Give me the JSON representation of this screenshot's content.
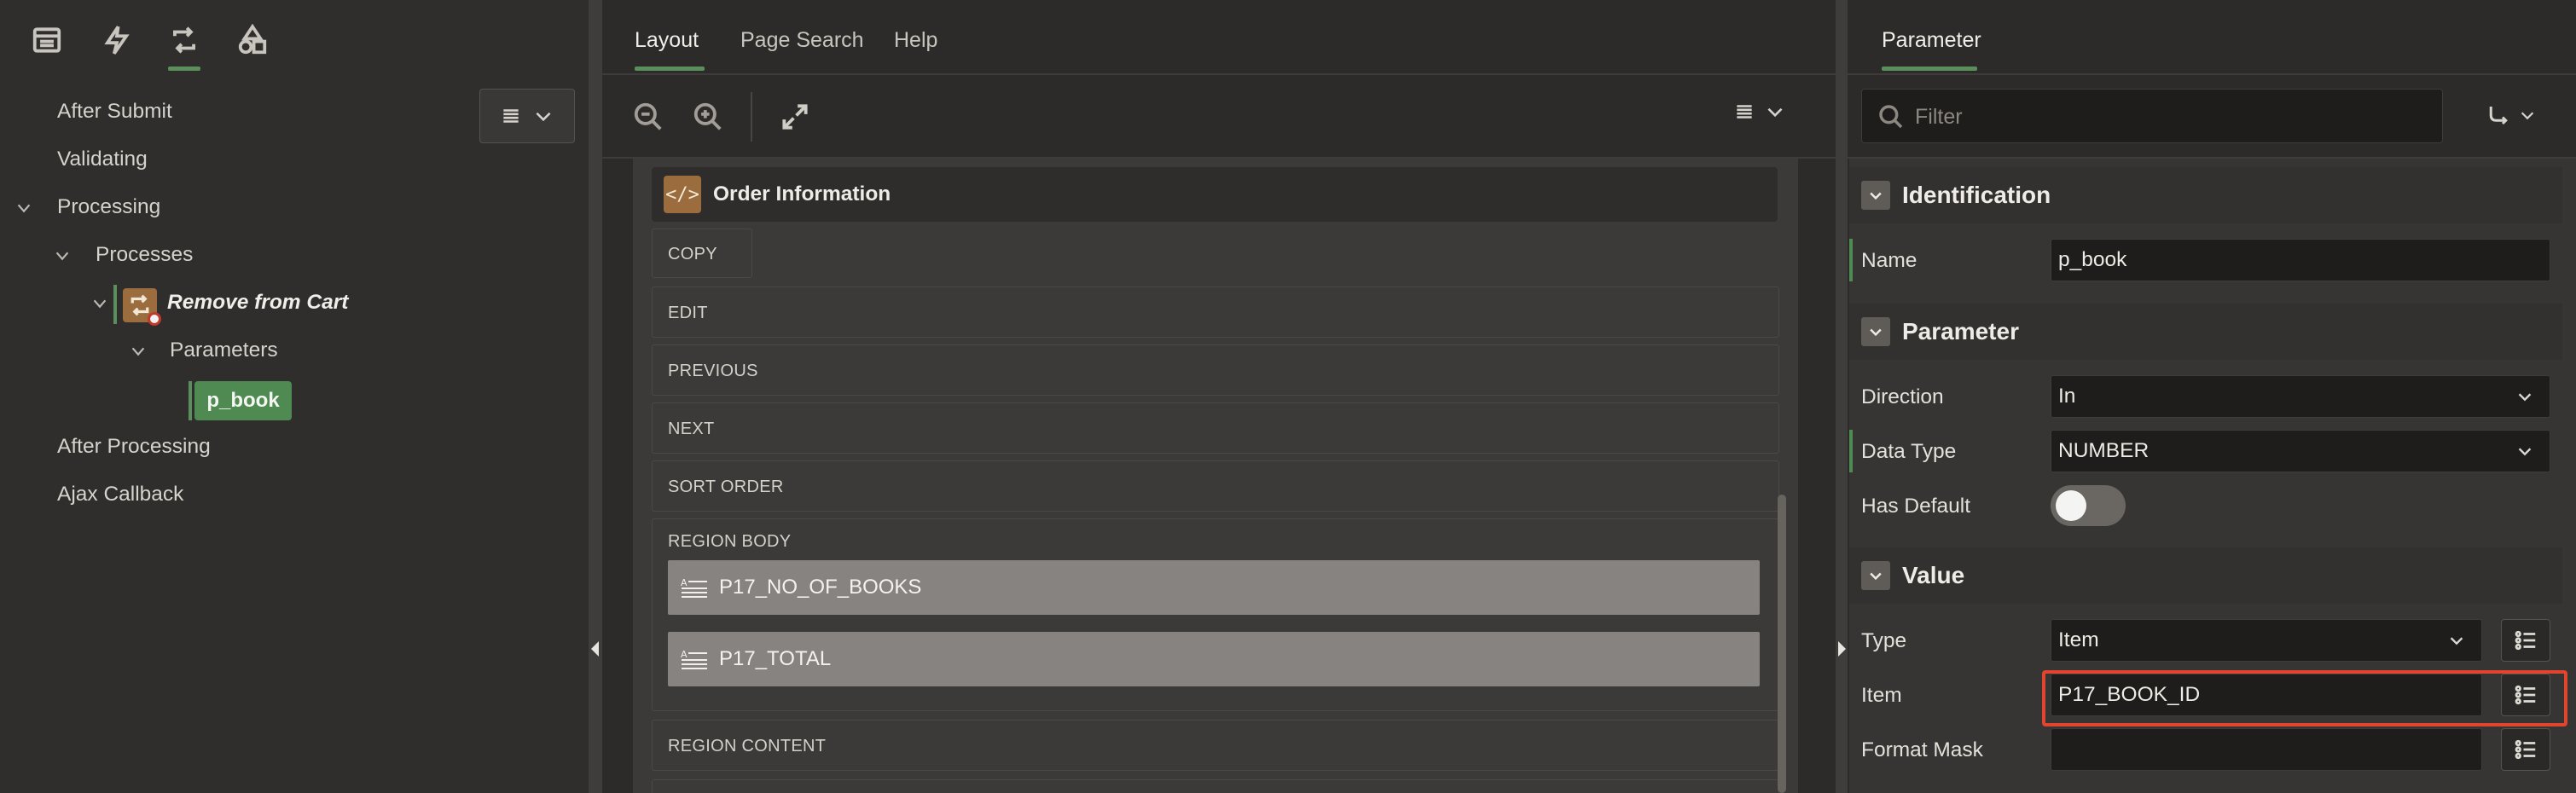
{
  "left_panel": {
    "tree": {
      "after_submit": "After Submit",
      "validating": "Validating",
      "processing": "Processing",
      "processes": "Processes",
      "remove_from_cart": "Remove from Cart",
      "parameters": "Parameters",
      "p_book": "p_book",
      "after_processing": "After Processing",
      "ajax_callback": "Ajax Callback"
    },
    "top_tab_icons": [
      "rendering-icon",
      "dynamic-actions-icon",
      "processing-icon",
      "shared-components-icon"
    ],
    "active_tab_index": 2
  },
  "center_panel": {
    "tabs": [
      "Layout",
      "Page Search",
      "Help"
    ],
    "active_tab": "Layout",
    "region": {
      "title": "Order Information",
      "slots": {
        "copy": "COPY",
        "edit": "EDIT",
        "previous": "PREVIOUS",
        "next": "NEXT",
        "sort_order": "SORT ORDER",
        "region_body": "REGION BODY",
        "region_content": "REGION CONTENT"
      },
      "items": [
        "P17_NO_OF_BOOKS",
        "P17_TOTAL"
      ]
    }
  },
  "right_panel": {
    "tab": "Parameter",
    "filter_placeholder": "Filter",
    "groups": {
      "identification": "Identification",
      "parameter": "Parameter",
      "value": "Value"
    },
    "props": {
      "name_label": "Name",
      "name_value": "p_book",
      "direction_label": "Direction",
      "direction_value": "In",
      "data_type_label": "Data Type",
      "data_type_value": "NUMBER",
      "has_default_label": "Has Default",
      "has_default_on": false,
      "type_label": "Type",
      "type_value": "Item",
      "item_label": "Item",
      "item_value": "P17_BOOK_ID",
      "format_mask_label": "Format Mask",
      "format_mask_value": ""
    },
    "colors": {
      "accent_green": "#5a8f5c",
      "highlight_red": "#e1452d"
    }
  }
}
